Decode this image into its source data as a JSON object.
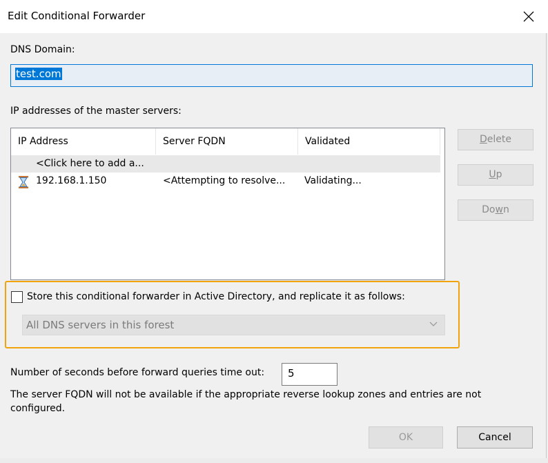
{
  "window": {
    "title": "Edit Conditional Forwarder"
  },
  "dns_domain": {
    "label": "DNS Domain:",
    "value": "test.com"
  },
  "master_servers": {
    "label": "IP addresses of the master servers:",
    "columns": [
      "IP Address",
      "Server FQDN",
      "Validated"
    ],
    "add_row": "<Click here to add a...",
    "rows": [
      {
        "icon": "hourglass-icon",
        "ip": "192.168.1.150",
        "fqdn": "<Attempting to resolve...",
        "validated": "Validating..."
      }
    ]
  },
  "side_buttons": {
    "delete": {
      "prefix": "",
      "underline": "D",
      "rest": "elete"
    },
    "up": {
      "prefix": "",
      "underline": "U",
      "rest": "p"
    },
    "down": {
      "prefix": "Do",
      "underline": "w",
      "rest": "n"
    }
  },
  "ad_store": {
    "checkbox_label": "Store this conditional forwarder in Active Directory, and replicate it as follows:",
    "checked": false,
    "replication_scope": "All DNS servers in this forest"
  },
  "timeout": {
    "label": "Number of seconds before forward queries time out:",
    "value": "5"
  },
  "note": "The server FQDN will not be available if the appropriate reverse lookup zones and entries are not configured.",
  "buttons": {
    "ok": "OK",
    "cancel": "Cancel"
  },
  "colors": {
    "accent": "#0078d7",
    "highlight": "#f0a30a"
  }
}
